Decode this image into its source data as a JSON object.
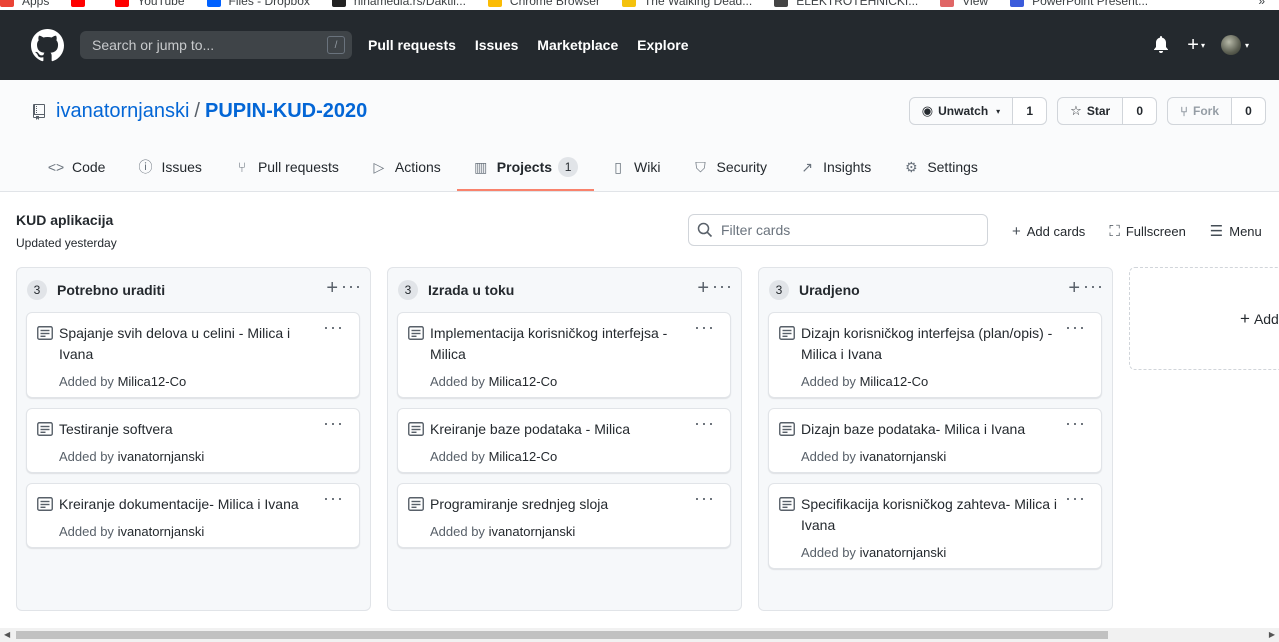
{
  "bookmarks": {
    "items": [
      {
        "label": "Apps",
        "color": "#ea4335"
      },
      {
        "label": "",
        "color": "#ff0000"
      },
      {
        "label": "YouTube",
        "color": "#ff0000"
      },
      {
        "label": "Files - Dropbox",
        "color": "#0061ff"
      },
      {
        "label": "ninamedia.rs/Daktil...",
        "color": "#222222"
      },
      {
        "label": "Chrome Browser",
        "color": "#fbbc05"
      },
      {
        "label": "The Walking Dead...",
        "color": "#f4c20d"
      },
      {
        "label": "ELEKTROTEHNICKI...",
        "color": "#444444"
      },
      {
        "label": "View",
        "color": "#e06666"
      },
      {
        "label": "PowerPoint Present...",
        "color": "#3b5bdb"
      }
    ],
    "overflow": "»"
  },
  "header": {
    "search_placeholder": "Search or jump to...",
    "search_key": "/",
    "nav": [
      "Pull requests",
      "Issues",
      "Marketplace",
      "Explore"
    ],
    "plus": "+",
    "caret": "▾"
  },
  "repo": {
    "owner": "ivanatornjanski",
    "separator": "/",
    "name": "PUPIN-KUD-2020",
    "watch_label": "Unwatch",
    "watch_count": "1",
    "star_label": "Star",
    "star_count": "0",
    "fork_label": "Fork",
    "fork_count": "0"
  },
  "tabs": [
    {
      "label": "Code",
      "icon": "code-icon",
      "glyph": "<>"
    },
    {
      "label": "Issues",
      "icon": "issue-icon",
      "glyph": "ⓘ"
    },
    {
      "label": "Pull requests",
      "icon": "pull-request-icon",
      "glyph": "⑂"
    },
    {
      "label": "Actions",
      "icon": "play-icon",
      "glyph": "▷"
    },
    {
      "label": "Projects",
      "icon": "project-icon",
      "glyph": "▥",
      "badge": "1",
      "active": true
    },
    {
      "label": "Wiki",
      "icon": "book-icon",
      "glyph": "▯"
    },
    {
      "label": "Security",
      "icon": "shield-icon",
      "glyph": "⛉"
    },
    {
      "label": "Insights",
      "icon": "graph-icon",
      "glyph": "↗"
    },
    {
      "label": "Settings",
      "icon": "gear-icon",
      "glyph": "⚙"
    }
  ],
  "project": {
    "name": "KUD aplikacija",
    "updated": "Updated yesterday",
    "filter_placeholder": "Filter cards",
    "add_cards": "Add cards",
    "fullscreen": "Fullscreen",
    "menu": "Menu",
    "add_column": "Add"
  },
  "columns": [
    {
      "count": "3",
      "title": "Potrebno uraditi",
      "cards": [
        {
          "title": "Spajanje svih delova u celini - Milica i Ivana",
          "added_by_label": "Added by",
          "author": "Milica12-Co"
        },
        {
          "title": "Testiranje softvera",
          "added_by_label": "Added by",
          "author": "ivanatornjanski"
        },
        {
          "title": "Kreiranje dokumentacije- Milica i Ivana",
          "added_by_label": "Added by",
          "author": "ivanatornjanski"
        }
      ]
    },
    {
      "count": "3",
      "title": "Izrada u toku",
      "cards": [
        {
          "title": "Implementacija korisničkog interfejsa - Milica",
          "added_by_label": "Added by",
          "author": "Milica12-Co"
        },
        {
          "title": "Kreiranje baze podataka - Milica",
          "added_by_label": "Added by",
          "author": "Milica12-Co"
        },
        {
          "title": "Programiranje srednjeg sloja",
          "added_by_label": "Added by",
          "author": "ivanatornjanski"
        }
      ]
    },
    {
      "count": "3",
      "title": "Uradjeno",
      "cards": [
        {
          "title": "Dizajn korisničkog interfejsa (plan/opis) - Milica i Ivana",
          "added_by_label": "Added by",
          "author": "Milica12-Co"
        },
        {
          "title": "Dizajn baze podataka- Milica i Ivana",
          "added_by_label": "Added by",
          "author": "ivanatornjanski"
        },
        {
          "title": "Specifikacija korisničkog zahteva- Milica i Ivana",
          "added_by_label": "Added by",
          "author": "ivanatornjanski"
        }
      ]
    }
  ],
  "colors": {
    "header_bg": "#24292e",
    "link": "#0366d6",
    "active_tab": "#f9826c"
  }
}
